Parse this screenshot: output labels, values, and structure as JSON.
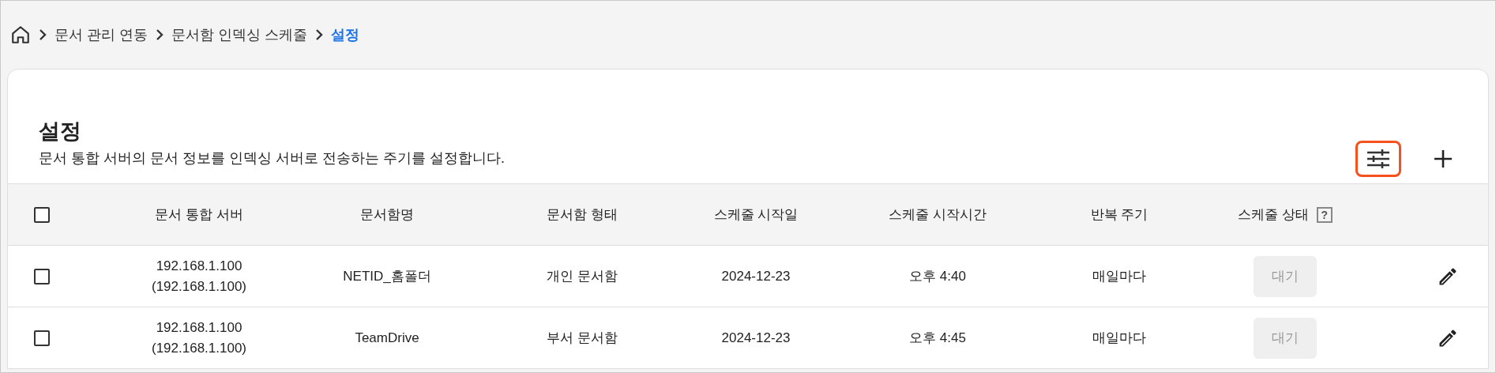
{
  "breadcrumb": [
    {
      "label": "문서 관리 연동",
      "current": false
    },
    {
      "label": "문서함 인덱싱 스케줄",
      "current": false
    },
    {
      "label": "설정",
      "current": true
    }
  ],
  "page": {
    "title": "설정",
    "description": "문서 통합 서버의 문서 정보를 인덱싱 서버로 전송하는 주기를 설정합니다.",
    "filter_button": {
      "highlighted": true
    }
  },
  "table": {
    "select_all": {
      "checked": false
    },
    "columns": [
      "문서 통합 서버",
      "문서함명",
      "문서함 형태",
      "스케줄 시작일",
      "스케줄 시작시간",
      "반복 주기",
      "스케줄 상태"
    ],
    "help_mark": "?",
    "rows": [
      {
        "checked": false,
        "server": "192.168.1.100",
        "server_detail": "(192.168.1.100)",
        "name": "NETID_홈폴더",
        "type": "개인 문서함",
        "start_date": "2024-12-23",
        "start_time": "오후 4:40",
        "repeat": "매일마다",
        "status": {
          "label": "대기",
          "disabled": true
        }
      },
      {
        "checked": false,
        "server": "192.168.1.100",
        "server_detail": "(192.168.1.100)",
        "name": "TeamDrive",
        "type": "부서 문서함",
        "start_date": "2024-12-23",
        "start_time": "오후 4:45",
        "repeat": "매일마다",
        "status": {
          "label": "대기",
          "disabled": true
        }
      }
    ]
  }
}
